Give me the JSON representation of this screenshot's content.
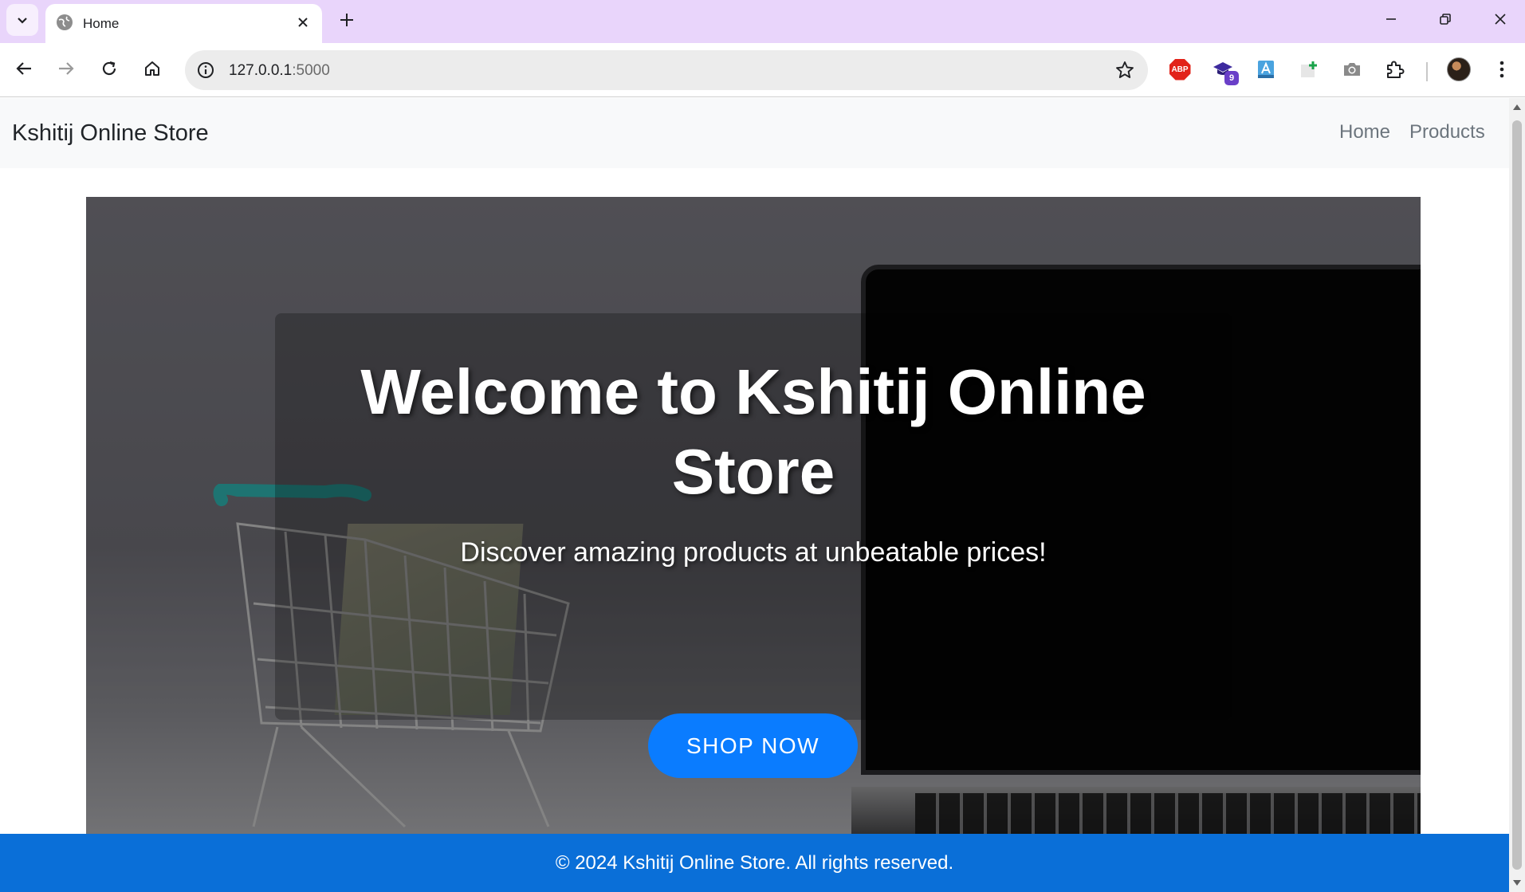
{
  "browser": {
    "tab": {
      "title": "Home",
      "icon": "globe-icon"
    },
    "address_bar": {
      "url_host": "127.0.0.1",
      "url_port": ":5000"
    },
    "extensions": [
      {
        "name": "adblock-plus-icon",
        "label": "ABP"
      },
      {
        "name": "extension-badge-icon",
        "badge": "9"
      },
      {
        "name": "translate-extension-icon"
      },
      {
        "name": "screenshot-add-icon"
      },
      {
        "name": "camera-icon"
      },
      {
        "name": "extensions-puzzle-icon"
      }
    ]
  },
  "site": {
    "brand": "Kshitij Online Store",
    "nav": [
      "Home",
      "Products"
    ],
    "hero": {
      "title": "Welcome to Kshitij Online Store",
      "subtitle": "Discover amazing products at unbeatable prices!",
      "cta": "SHOP NOW"
    },
    "footer": "© 2024 Kshitij Online Store. All rights reserved."
  },
  "colors": {
    "titlebar": "#e9d5fb",
    "cta": "#0a7cff",
    "footer": "#0a6fd8"
  }
}
